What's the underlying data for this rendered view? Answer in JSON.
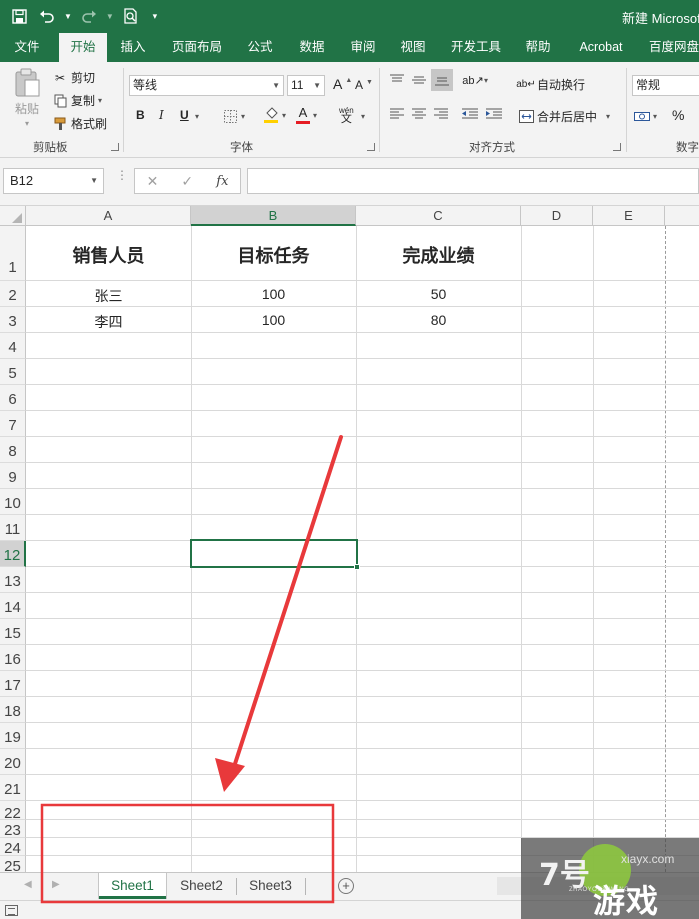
{
  "titlebar": {
    "title": "新建 Microsoft",
    "qat": {
      "save_icon": "save-icon",
      "undo_icon": "undo-icon",
      "redo_icon": "redo-icon",
      "print_preview_icon": "print-preview-icon",
      "customize_icon": "customize-qat-icon"
    }
  },
  "ribbon_tabs": [
    "文件",
    "开始",
    "插入",
    "页面布局",
    "公式",
    "数据",
    "审阅",
    "视图",
    "开发工具",
    "帮助",
    "Acrobat",
    "百度网盘"
  ],
  "ribbon_active_tab": "开始",
  "ribbon": {
    "clipboard": {
      "paste": "粘贴",
      "cut": "剪切",
      "copy": "复制",
      "format_painter": "格式刷",
      "label": "剪贴板"
    },
    "font": {
      "font_name": "等线",
      "font_size": "11",
      "bold": "B",
      "italic": "I",
      "underline": "U",
      "grow": "A",
      "shrink": "A",
      "font_color": "A",
      "phonetic": "wén",
      "label": "字体"
    },
    "alignment": {
      "wrap_text": "自动换行",
      "merge_center": "合并后居中",
      "label": "对齐方式"
    },
    "number": {
      "format": "常规",
      "percent": "%",
      "label": "数字"
    }
  },
  "formula_bar": {
    "name_box": "B12",
    "cancel": "✕",
    "enter": "✓",
    "fx": "fx",
    "formula": ""
  },
  "sheet": {
    "columns": [
      "A",
      "B",
      "C",
      "D",
      "E"
    ],
    "selected_column": "B",
    "rows": [
      "1",
      "2",
      "3",
      "4",
      "5",
      "6",
      "7",
      "8",
      "9",
      "10",
      "11",
      "12",
      "13",
      "14",
      "15",
      "16",
      "17",
      "18",
      "19",
      "20",
      "21",
      "22",
      "23",
      "24",
      "25"
    ],
    "selected_row": "12",
    "selected_cell": "B12",
    "headers": [
      "销售人员",
      "目标任务",
      "完成业绩"
    ],
    "data": [
      [
        "张三",
        "100",
        "50"
      ],
      [
        "李四",
        "100",
        "80"
      ]
    ]
  },
  "sheet_tabs": [
    "Sheet1",
    "Sheet2",
    "Sheet3"
  ],
  "active_sheet": "Sheet1",
  "annotation": {
    "arrow_color": "#e8393b",
    "box_color": "#e8393b"
  },
  "watermark": {
    "logo": "7号",
    "text": "游戏",
    "url": "xiayx.com",
    "pinyin": "ZHAOYOUXIWANG"
  },
  "colors": {
    "excel_green": "#217346",
    "ribbon_bg": "#f3f3f3",
    "grid_line": "#d9d9d9"
  }
}
